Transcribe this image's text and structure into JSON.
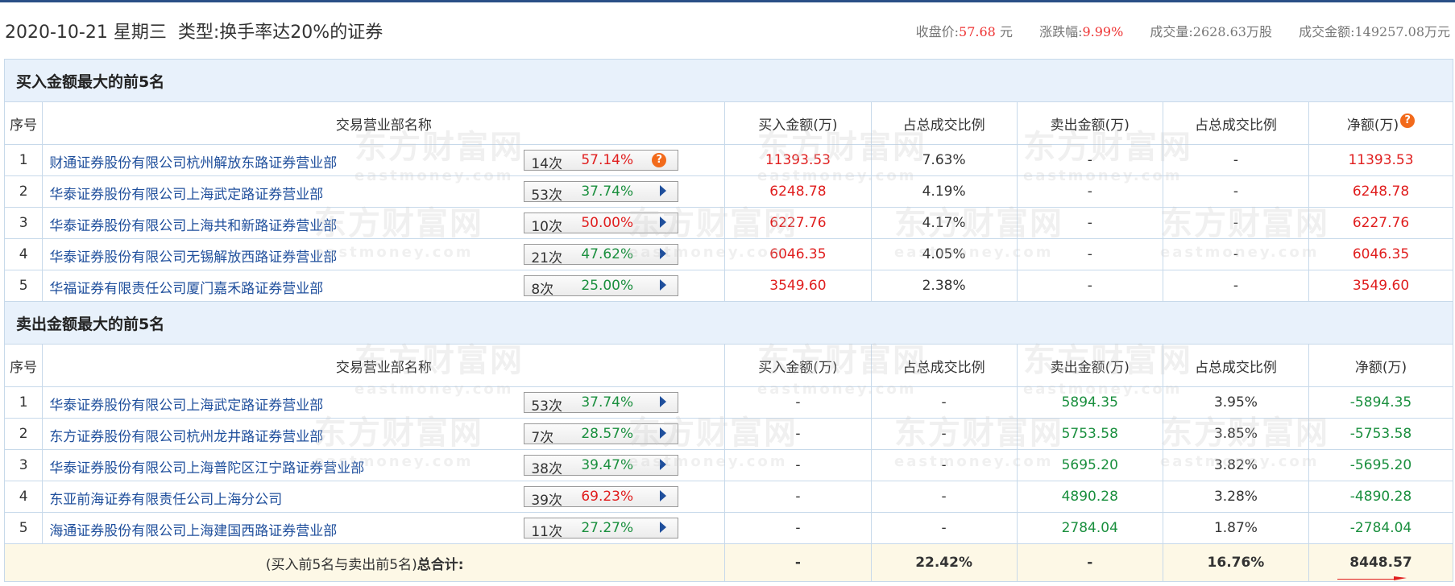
{
  "header": {
    "date": "2020-10-21",
    "weekday": "星期三",
    "type_label": "类型:",
    "type_value": "换手率达20%的证券",
    "close_label": "收盘价:",
    "close_value": "57.68",
    "close_unit": "元",
    "change_label": "涨跌幅:",
    "change_value": "9.99%",
    "volume_label": "成交量:",
    "volume_value": "2628.63万股",
    "turnover_label": "成交金额:",
    "turnover_value": "149257.08万元"
  },
  "watermark": {
    "cn": "东方财富网",
    "en": "eastmoney.com"
  },
  "buy_section": {
    "title": "买入金额最大的前5名",
    "columns": [
      "序号",
      "交易营业部名称",
      "买入金额(万)",
      "占总成交比例",
      "卖出金额(万)",
      "占总成交比例",
      "净额(万)"
    ],
    "help_icon": "?",
    "rows": [
      {
        "no": "1",
        "name": "财通证券股份有限公司杭州解放东路证券营业部",
        "times": "14次",
        "rate": "57.14%",
        "rate_color": "red",
        "icon": "question",
        "buy": "11393.53",
        "buy_pct": "7.63%",
        "sell": "-",
        "sell_pct": "-",
        "net": "11393.53"
      },
      {
        "no": "2",
        "name": "华泰证券股份有限公司上海武定路证券营业部",
        "times": "53次",
        "rate": "37.74%",
        "rate_color": "green",
        "icon": "arrow",
        "buy": "6248.78",
        "buy_pct": "4.19%",
        "sell": "-",
        "sell_pct": "-",
        "net": "6248.78"
      },
      {
        "no": "3",
        "name": "华泰证券股份有限公司上海共和新路证券营业部",
        "times": "10次",
        "rate": "50.00%",
        "rate_color": "red",
        "icon": "arrow",
        "buy": "6227.76",
        "buy_pct": "4.17%",
        "sell": "-",
        "sell_pct": "-",
        "net": "6227.76"
      },
      {
        "no": "4",
        "name": "华泰证券股份有限公司无锡解放西路证券营业部",
        "times": "21次",
        "rate": "47.62%",
        "rate_color": "green",
        "icon": "arrow",
        "buy": "6046.35",
        "buy_pct": "4.05%",
        "sell": "-",
        "sell_pct": "-",
        "net": "6046.35"
      },
      {
        "no": "5",
        "name": "华福证券有限责任公司厦门嘉禾路证券营业部",
        "times": "8次",
        "rate": "25.00%",
        "rate_color": "green",
        "icon": "arrow",
        "buy": "3549.60",
        "buy_pct": "2.38%",
        "sell": "-",
        "sell_pct": "-",
        "net": "3549.60"
      }
    ]
  },
  "sell_section": {
    "title": "卖出金额最大的前5名",
    "columns": [
      "序号",
      "交易营业部名称",
      "买入金额(万)",
      "占总成交比例",
      "卖出金额(万)",
      "占总成交比例",
      "净额(万)"
    ],
    "rows": [
      {
        "no": "1",
        "name": "华泰证券股份有限公司上海武定路证券营业部",
        "times": "53次",
        "rate": "37.74%",
        "rate_color": "green",
        "icon": "arrow",
        "buy": "-",
        "buy_pct": "-",
        "sell": "5894.35",
        "sell_pct": "3.95%",
        "net": "-5894.35"
      },
      {
        "no": "2",
        "name": "东方证券股份有限公司杭州龙井路证券营业部",
        "times": "7次",
        "rate": "28.57%",
        "rate_color": "green",
        "icon": "arrow",
        "buy": "-",
        "buy_pct": "-",
        "sell": "5753.58",
        "sell_pct": "3.85%",
        "net": "-5753.58"
      },
      {
        "no": "3",
        "name": "华泰证券股份有限公司上海普陀区江宁路证券营业部",
        "times": "38次",
        "rate": "39.47%",
        "rate_color": "green",
        "icon": "arrow",
        "buy": "-",
        "buy_pct": "-",
        "sell": "5695.20",
        "sell_pct": "3.82%",
        "net": "-5695.20"
      },
      {
        "no": "4",
        "name": "东亚前海证券有限责任公司上海分公司",
        "times": "39次",
        "rate": "69.23%",
        "rate_color": "red",
        "icon": "arrow",
        "buy": "-",
        "buy_pct": "-",
        "sell": "4890.28",
        "sell_pct": "3.28%",
        "net": "-4890.28"
      },
      {
        "no": "5",
        "name": "海通证券股份有限公司上海建国西路证券营业部",
        "times": "11次",
        "rate": "27.27%",
        "rate_color": "green",
        "icon": "arrow",
        "buy": "-",
        "buy_pct": "-",
        "sell": "2784.04",
        "sell_pct": "1.87%",
        "net": "-2784.04"
      }
    ]
  },
  "total": {
    "label_prefix": "(买入前5名与卖出前5名)",
    "label_bold": "总合计:",
    "buy": "-",
    "buy_pct": "22.42%",
    "sell": "-",
    "sell_pct": "16.76%",
    "net": "8448.57"
  },
  "colors": {
    "red": "#e01e1e",
    "green": "#1a8f3e",
    "link": "#1f4f9c",
    "accent_orange": "#f26a1b",
    "section_bg": "#e8f1fb",
    "total_bg": "#fdf8e6"
  }
}
